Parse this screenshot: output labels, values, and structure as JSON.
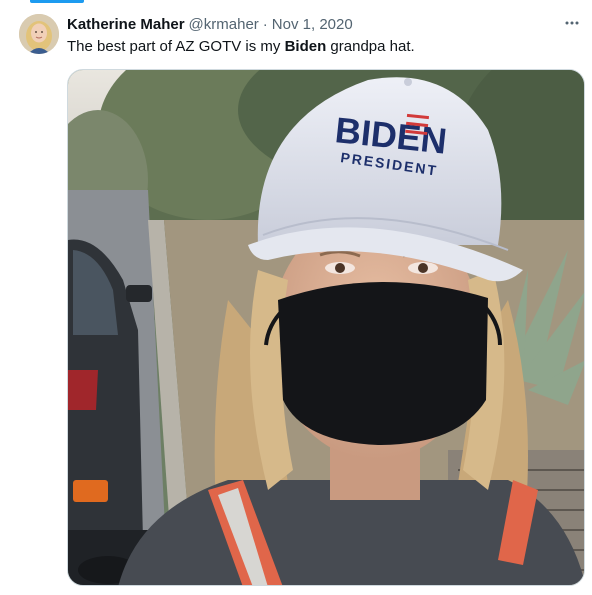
{
  "tweet": {
    "author_name": "Katherine Maher",
    "handle": "@krmaher",
    "separator": "·",
    "date": "Nov 1, 2020",
    "text_before": "The best part of AZ GOTV is my ",
    "text_bold": "Biden",
    "text_after": " grandpa hat.",
    "more_icon": "more-horizontal-icon"
  },
  "photo": {
    "hat_text_1": "BIDEN",
    "hat_text_2": "PRESIDENT"
  },
  "colors": {
    "accent": "#1d9bf0",
    "handle_gray": "#536471",
    "text": "#0f1419",
    "hat_blue": "#1d2f6b",
    "hat_red": "#d23a3a"
  }
}
